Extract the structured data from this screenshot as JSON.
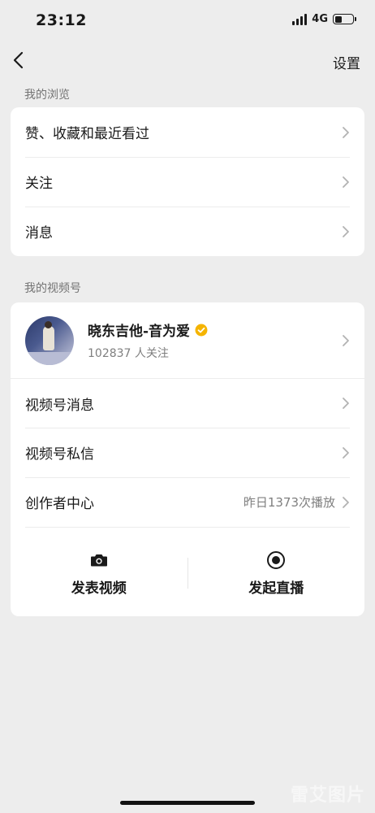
{
  "status_bar": {
    "time": "23:12",
    "network": "4G",
    "battery_level": 0.4
  },
  "nav": {
    "back_icon": "chevron-left-icon",
    "settings_label": "设置"
  },
  "browse_section": {
    "label": "我的浏览",
    "items": [
      {
        "label": "赞、收藏和最近看过"
      },
      {
        "label": "关注"
      },
      {
        "label": "消息"
      }
    ]
  },
  "channel_section": {
    "label": "我的视频号",
    "profile": {
      "name": "晓东吉他-音为爱",
      "followers": "102837 人关注",
      "verified_color": "#f5b400"
    },
    "items": [
      {
        "label": "视频号消息",
        "extra": ""
      },
      {
        "label": "视频号私信",
        "extra": ""
      },
      {
        "label": "创作者中心",
        "extra": "昨日1373次播放"
      }
    ],
    "actions": [
      {
        "label": "发表视频",
        "icon": "camera-icon"
      },
      {
        "label": "发起直播",
        "icon": "live-record-icon"
      }
    ]
  },
  "watermark": "雷艾图片"
}
